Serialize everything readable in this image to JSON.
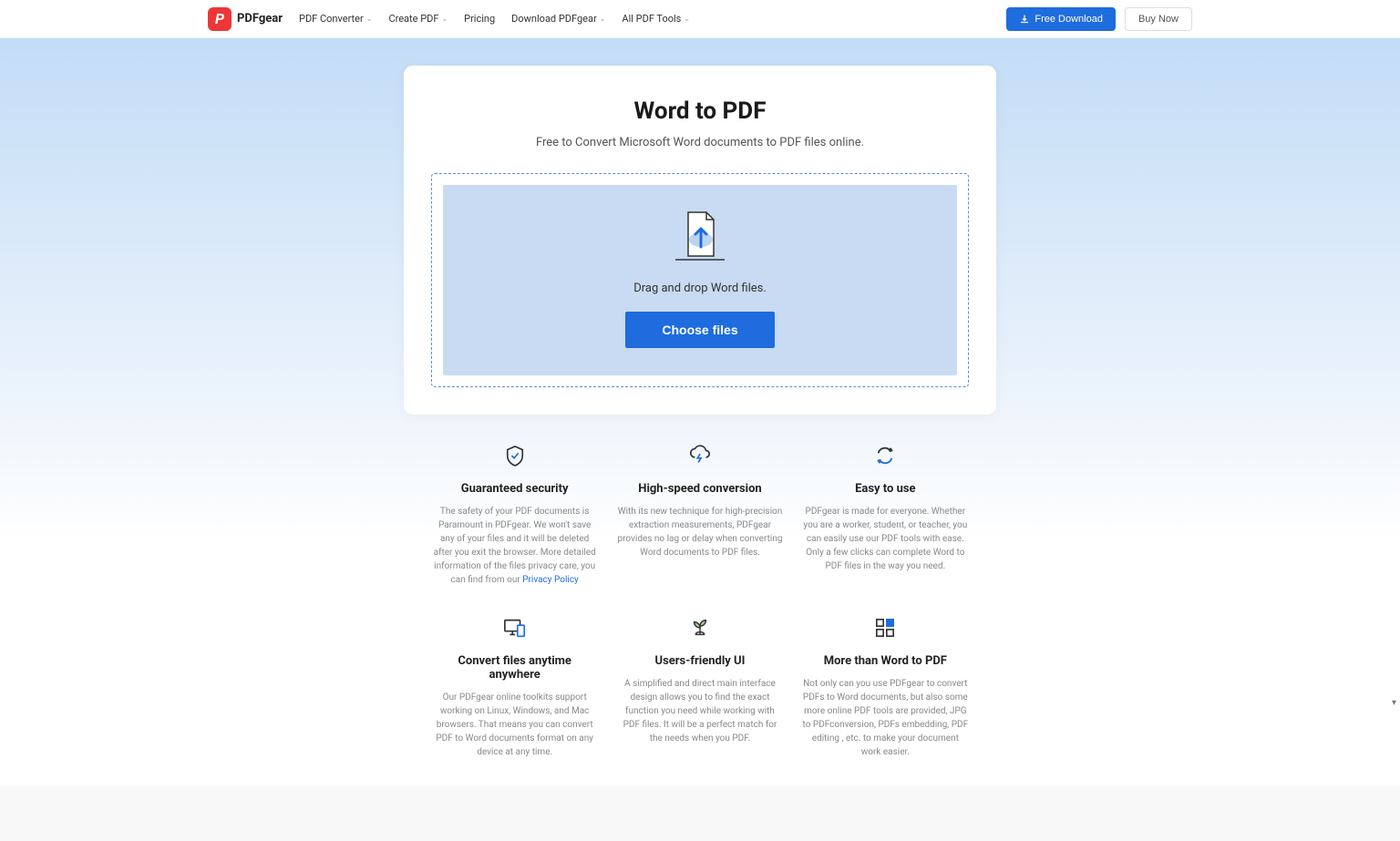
{
  "header": {
    "brand": "PDFgear",
    "nav": [
      {
        "label": "PDF Converter",
        "dropdown": true
      },
      {
        "label": "Create PDF",
        "dropdown": true
      },
      {
        "label": "Pricing",
        "dropdown": false
      },
      {
        "label": "Download PDFgear",
        "dropdown": true
      },
      {
        "label": "All PDF Tools",
        "dropdown": true
      }
    ],
    "download_btn": "Free Download",
    "buy_btn": "Buy Now"
  },
  "hero": {
    "title": "Word to PDF",
    "subtitle": "Free to Convert Microsoft Word documents to PDF files online.",
    "drop_text": "Drag and drop Word files.",
    "choose_btn": "Choose files"
  },
  "features": [
    {
      "icon": "shield",
      "title": "Guaranteed security",
      "desc": "The safety of your PDF documents is Paramount in PDFgear. We won't save any of your files and it will be deleted after you exit the browser. More detailed information of the files privacy care, you can find from our ",
      "link_text": "Privacy Policy"
    },
    {
      "icon": "bolt-cloud",
      "title": "High-speed conversion",
      "desc": "With its new technique for high-precision extraction measurements, PDFgear provides no lag or delay when converting Word documents to PDF files."
    },
    {
      "icon": "refresh",
      "title": "Easy to use",
      "desc": "PDFgear is made for everyone. Whether you are a worker, student, or teacher, you can easily use our PDF tools with ease. Only a few clicks can complete Word to PDF files in the way you need."
    },
    {
      "icon": "devices",
      "title": "Convert files anytime anywhere",
      "desc": "Our PDFgear online toolkits support working on Linux, Windows, and Mac browsers. That means you can convert PDF to Word documents format on any device at any time."
    },
    {
      "icon": "plant",
      "title": "Users-friendly UI",
      "desc": "A simplified and direct main interface design allows you to find the exact function you need while working with PDF files. It will be a perfect match for the needs when you PDF."
    },
    {
      "icon": "grid",
      "title": "More than Word to PDF",
      "desc": "Not only can you use PDFgear to convert PDFs to Word documents, but also some more online PDF tools are provided, JPG to PDFconversion, PDFs embedding, PDF editing , etc. to make your document work easier."
    }
  ]
}
